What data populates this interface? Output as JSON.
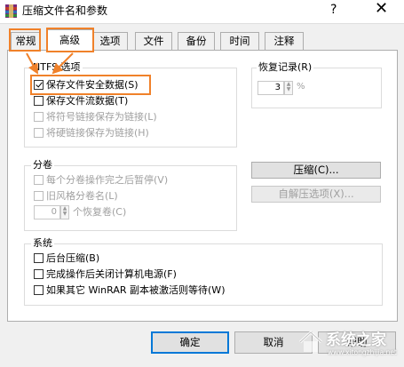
{
  "window": {
    "title": "压缩文件名和参数",
    "help_label": "?",
    "close_label": "✕"
  },
  "tabs": [
    {
      "label": "常规"
    },
    {
      "label": "高级"
    },
    {
      "label": "选项"
    },
    {
      "label": "文件"
    },
    {
      "label": "备份"
    },
    {
      "label": "时间"
    },
    {
      "label": "注释"
    }
  ],
  "ntfs": {
    "title": "NTFS 选项",
    "options": [
      {
        "label": "保存文件安全数据(S)",
        "checked": true,
        "enabled": true
      },
      {
        "label": "保存文件流数据(T)",
        "checked": false,
        "enabled": true
      },
      {
        "label": "将符号链接保存为链接(L)",
        "checked": false,
        "enabled": false
      },
      {
        "label": "将硬链接保存为链接(H)",
        "checked": false,
        "enabled": false
      }
    ]
  },
  "recovery": {
    "title": "恢复记录(R)",
    "value": "3",
    "unit": "%"
  },
  "split": {
    "title": "分卷",
    "options": [
      {
        "label": "每个分卷操作完之后暂停(V)",
        "checked": false,
        "enabled": false
      },
      {
        "label": "旧风格分卷名(L)",
        "checked": false,
        "enabled": false
      }
    ],
    "recovery_volumes_value": "0",
    "recovery_volumes_label": "个恢复卷(C)"
  },
  "side_buttons": {
    "compress": "压缩(C)...",
    "sfx_options": "自解压选项(X)..."
  },
  "system": {
    "title": "系统",
    "options": [
      {
        "label": "后台压缩(B)",
        "checked": false,
        "enabled": true
      },
      {
        "label": "完成操作后关闭计算机电源(F)",
        "checked": false,
        "enabled": true
      },
      {
        "label": "如果其它 WinRAR 副本被激活则等待(W)",
        "checked": false,
        "enabled": true
      }
    ]
  },
  "footer": {
    "ok": "确定",
    "cancel": "取消",
    "help": "帮助"
  },
  "watermark": {
    "text": "系统之家",
    "url": "www.xitongzhijia.net"
  },
  "colors": {
    "highlight": "#f0812a",
    "focus": "#0078d7",
    "disabled_text": "#a0a0a0"
  }
}
